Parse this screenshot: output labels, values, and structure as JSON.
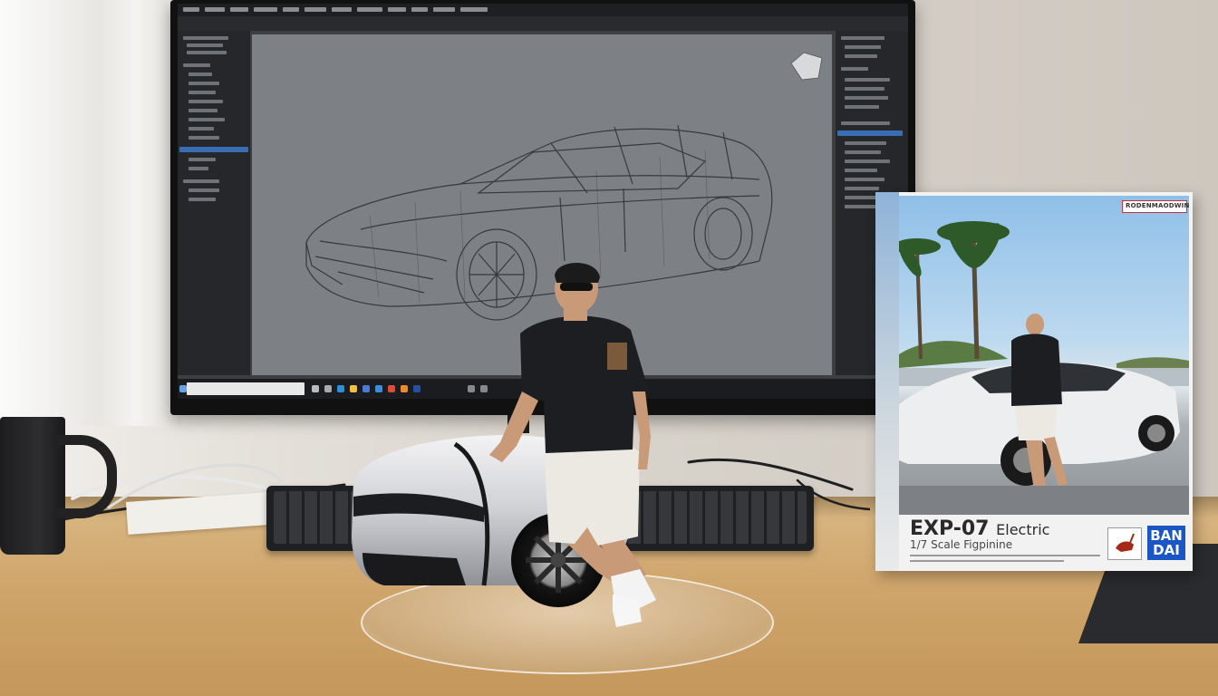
{
  "monitor": {
    "app": "3D modeling software",
    "viewport_subject": "wireframe sports car",
    "taskbar_search_placeholder": ""
  },
  "box": {
    "top_badge": "RODENMAODWIN",
    "title_main": "EXP-07",
    "title_suffix": "Electric",
    "subtitle": "1/7 Scale Figpinine",
    "brand_line1": "BAN",
    "brand_line2": "DAI"
  },
  "colors": {
    "wall": "#d8d3cb",
    "desk": "#cfa56b",
    "monitor_bezel": "#111111",
    "viewport_bg": "#7d8085",
    "selection_blue": "#3b6db3",
    "brand_blue": "#1a56c4",
    "car_silver": "#d9dade",
    "shirt": "#1d1e22",
    "shorts": "#ece9e2"
  },
  "icons": {
    "taskbar": [
      "windows-icon",
      "search-icon",
      "taskview-icon",
      "edge-icon",
      "folder-icon",
      "store-icon",
      "mail-icon",
      "chrome-icon",
      "blender-icon",
      "photoshop-icon"
    ]
  }
}
